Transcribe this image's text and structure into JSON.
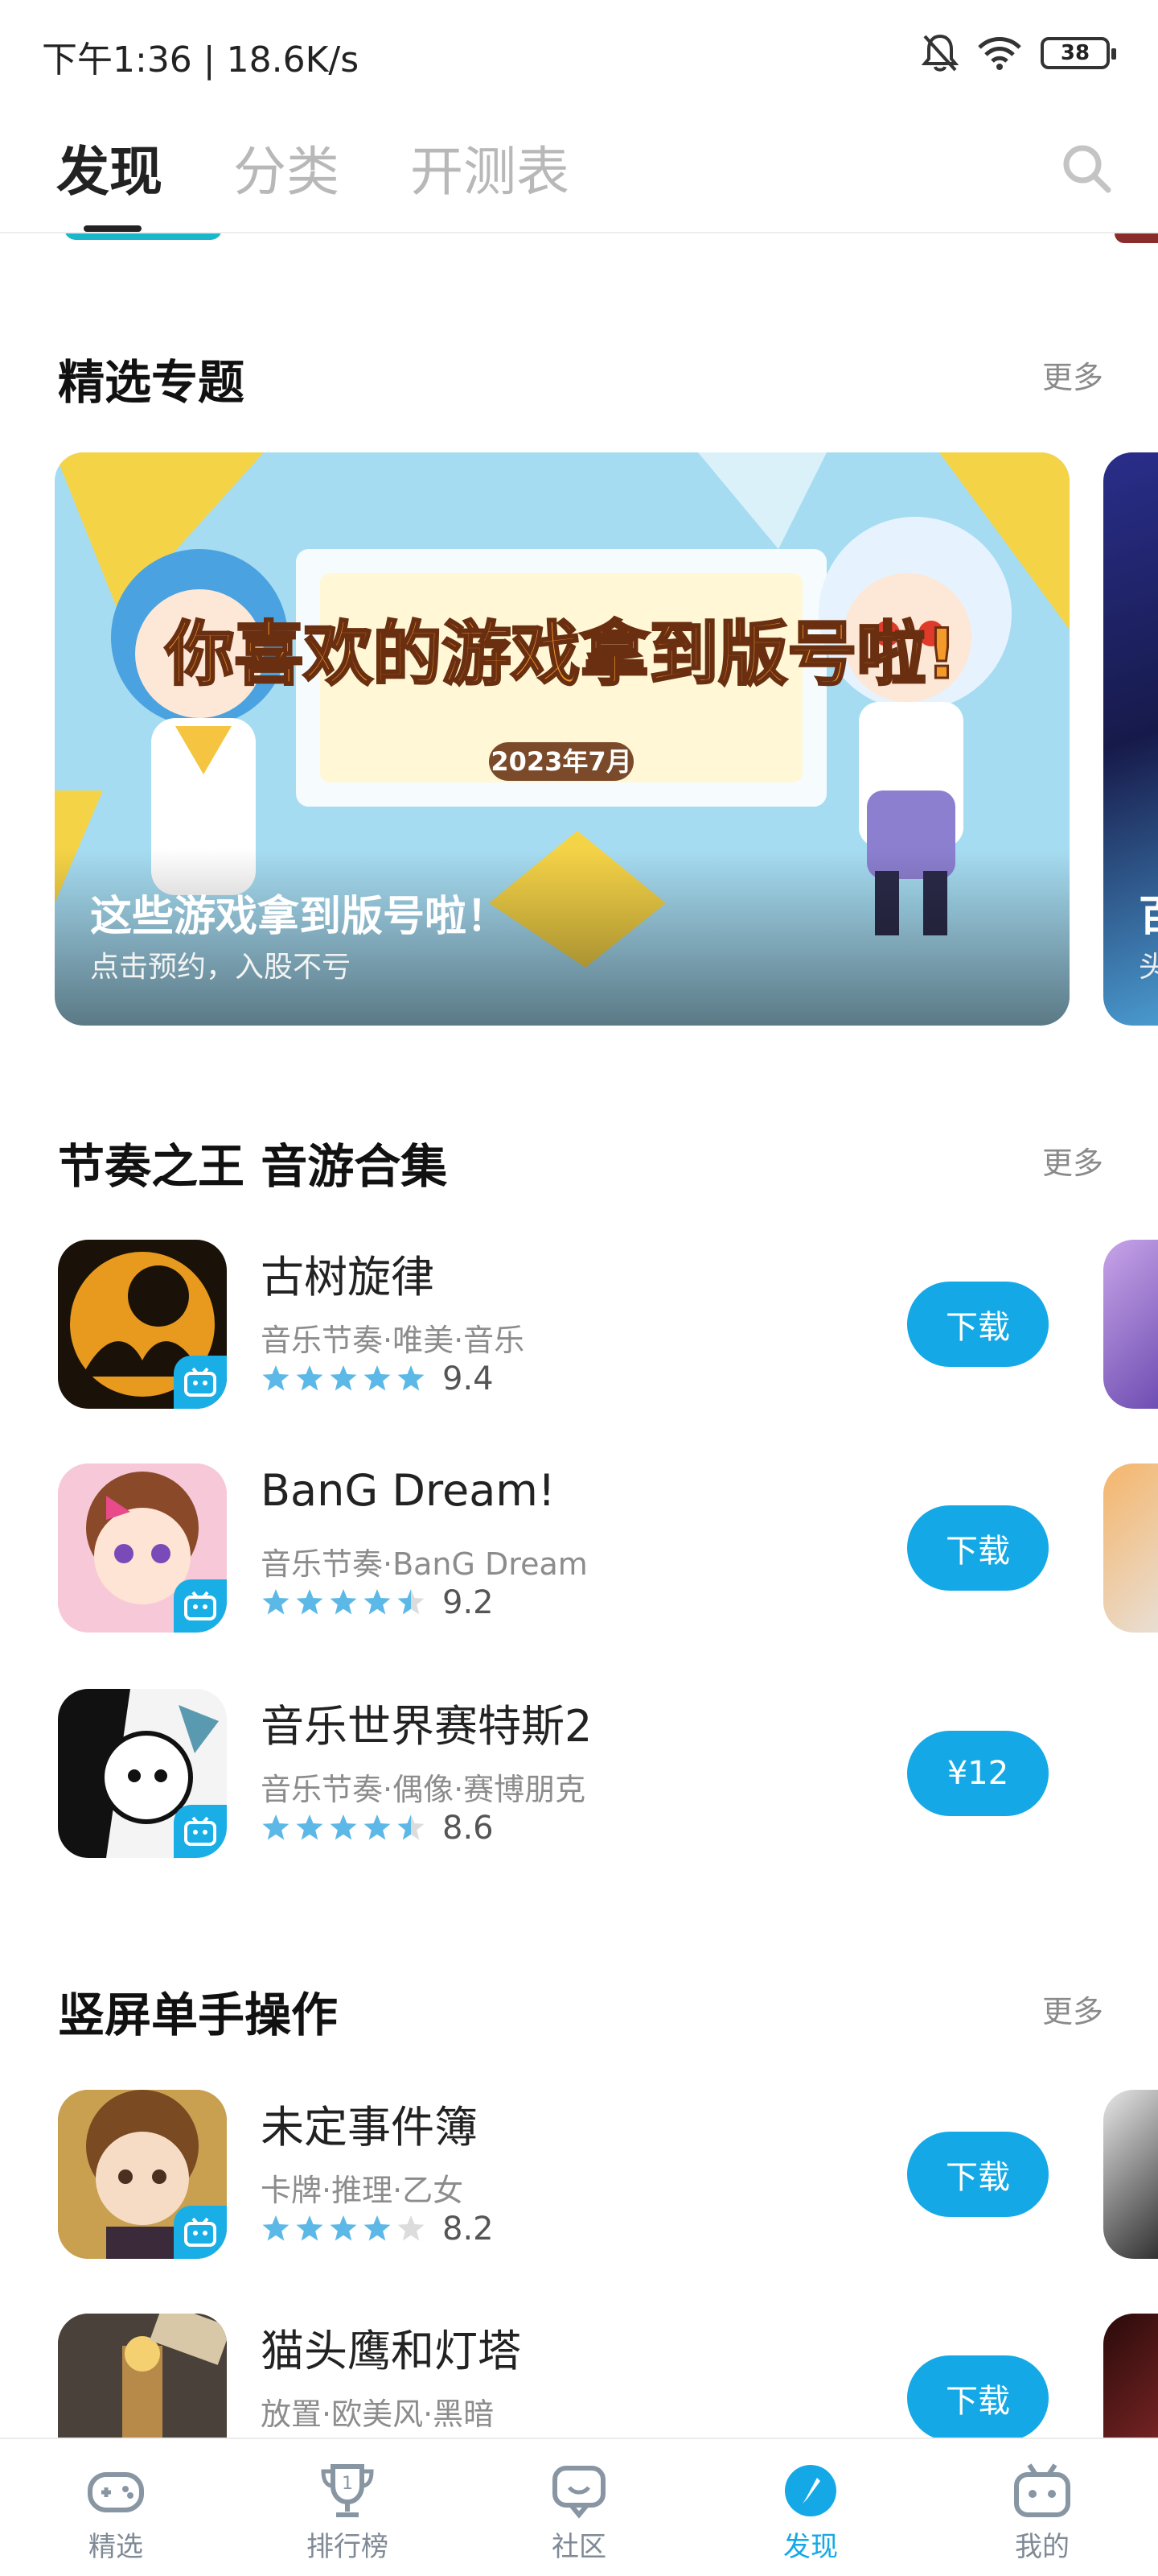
{
  "status_bar": {
    "time_speed": "下午1:36 | 18.6K/s",
    "battery": "38"
  },
  "top_tabs": [
    {
      "label": "发现",
      "active": true
    },
    {
      "label": "分类",
      "active": false
    },
    {
      "label": "开测表",
      "active": false
    }
  ],
  "featured": {
    "title": "精选专题",
    "more": "更多",
    "banner": {
      "headline": "你喜欢的游戏拿到版号啦!",
      "date_tag": "2023年7月",
      "title": "这些游戏拿到版号啦！",
      "subtitle": "点击预约，入股不亏"
    },
    "next_banner": {
      "title": "百",
      "subtitle": "头"
    }
  },
  "sections": [
    {
      "title": "节奏之王 音游合集",
      "more": "更多",
      "apps": [
        {
          "name": "古树旋律",
          "tags": "音乐节奏·唯美·音乐",
          "rating": 9.4,
          "stars": 5,
          "action": "下载"
        },
        {
          "name": "BanG Dream!",
          "tags": "音乐节奏·BanG Dream",
          "rating": 9.2,
          "stars": 4.5,
          "action": "下载"
        },
        {
          "name": "音乐世界赛特斯2",
          "tags": "音乐节奏·偶像·赛博朋克",
          "rating": 8.6,
          "stars": 4.5,
          "action": "¥12"
        }
      ]
    },
    {
      "title": "竖屏单手操作",
      "more": "更多",
      "apps": [
        {
          "name": "未定事件簿",
          "tags": "卡牌·推理·乙女",
          "rating": 8.2,
          "stars": 4,
          "action": "下载"
        },
        {
          "name": "猫头鹰和灯塔",
          "tags": "放置·欧美风·黑暗",
          "rating": null,
          "stars": null,
          "action": "下载"
        }
      ]
    }
  ],
  "bottom_nav": [
    {
      "label": "精选",
      "icon": "gamepad-icon",
      "active": false
    },
    {
      "label": "排行榜",
      "icon": "trophy-icon",
      "active": false
    },
    {
      "label": "社区",
      "icon": "chat-icon",
      "active": false
    },
    {
      "label": "发现",
      "icon": "compass-icon",
      "active": true
    },
    {
      "label": "我的",
      "icon": "bilibili-tv-icon",
      "active": false
    }
  ],
  "colors": {
    "accent": "#14a9e6",
    "star": "#5cb8e6",
    "star_empty": "#dcdcdc"
  }
}
